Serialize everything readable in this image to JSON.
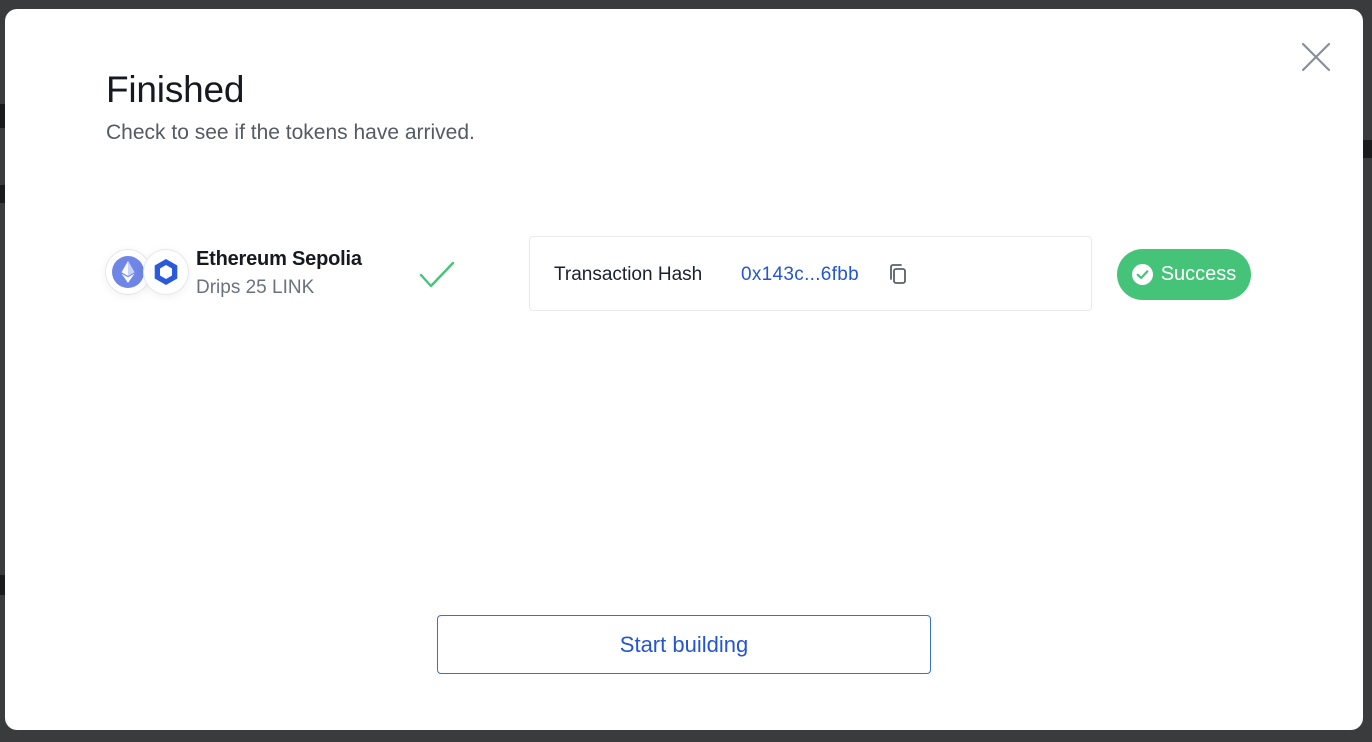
{
  "modal": {
    "title": "Finished",
    "subtitle": "Check to see if the tokens have arrived.",
    "close_icon": "close-icon"
  },
  "network": {
    "name": "Ethereum Sepolia",
    "drip": "Drips 25 LINK",
    "icons": [
      "ethereum-icon",
      "chainlink-icon"
    ],
    "status_icon": "checkmark-icon"
  },
  "transaction": {
    "label": "Transaction Hash",
    "hash": "0x143c...6fbb",
    "copy_icon": "copy-icon"
  },
  "status_badge": {
    "label": "Success",
    "color": "#45c479",
    "icon": "check-circle-icon"
  },
  "cta": {
    "label": "Start building"
  },
  "colors": {
    "accent": "#2456d4",
    "success": "#45c479",
    "text_primary": "#16191f",
    "text_secondary": "#555a63"
  }
}
